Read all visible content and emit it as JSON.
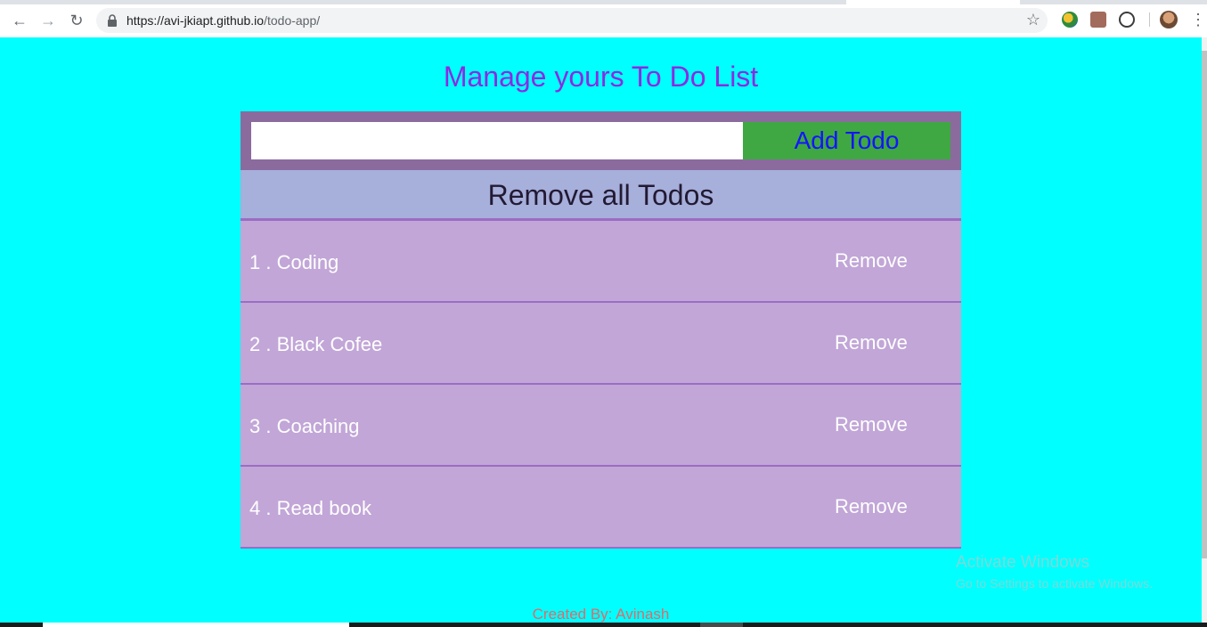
{
  "browser": {
    "url_host": "https://avi-jkiapt.github.io",
    "url_path": "/todo-app/"
  },
  "page": {
    "title": "Manage yours To Do List",
    "add_button_label": "Add Todo",
    "input_value": "",
    "remove_all_label": "Remove all Todos",
    "todos": [
      {
        "number": "1 . ",
        "text": "Coding",
        "remove_label": "Remove"
      },
      {
        "number": "2 . ",
        "text": "Black Cofee",
        "remove_label": "Remove"
      },
      {
        "number": "3 . ",
        "text": "Coaching",
        "remove_label": "Remove"
      },
      {
        "number": "4 . ",
        "text": "Read book",
        "remove_label": "Remove"
      }
    ],
    "footer": "Created By: Avinash"
  },
  "overlay": {
    "watermark_title": "Activate Windows",
    "watermark_subtitle": "Go to Settings to activate Windows."
  },
  "colors": {
    "page_bg": "#00ffff",
    "title": "#8a2be2",
    "add_bar": "#8b6b9e",
    "add_button": "#3fa843",
    "remove_all_bg": "#a7afdb",
    "todo_bg": "#c1a6d7"
  }
}
